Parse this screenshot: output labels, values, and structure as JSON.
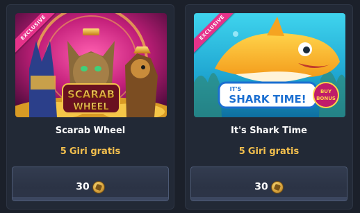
{
  "cards": [
    {
      "badge": "EXCLUSIVE",
      "art_title_line1": "SCARAB",
      "art_title_line2": "WHEEL",
      "title": "Scarab Wheel",
      "spins_count": "5",
      "spins_label": "Giri gratis",
      "price": "30",
      "price_icon": "coin-icon"
    },
    {
      "badge": "EXCLUSIVE",
      "art_title_prefix": "IT'S",
      "art_title_main": "SHARK TIME!",
      "art_badge_line1": "BUY",
      "art_badge_line2": "BONUS",
      "title": "It's Shark Time",
      "spins_count": "5",
      "spins_label": "Giri gratis",
      "price": "30",
      "price_icon": "coin-icon"
    }
  ],
  "colors": {
    "background": "#1b202a",
    "card": "#222936",
    "spins_text": "#f4c04e",
    "badge": "#e6328a",
    "button_border": "#4d5a75"
  }
}
